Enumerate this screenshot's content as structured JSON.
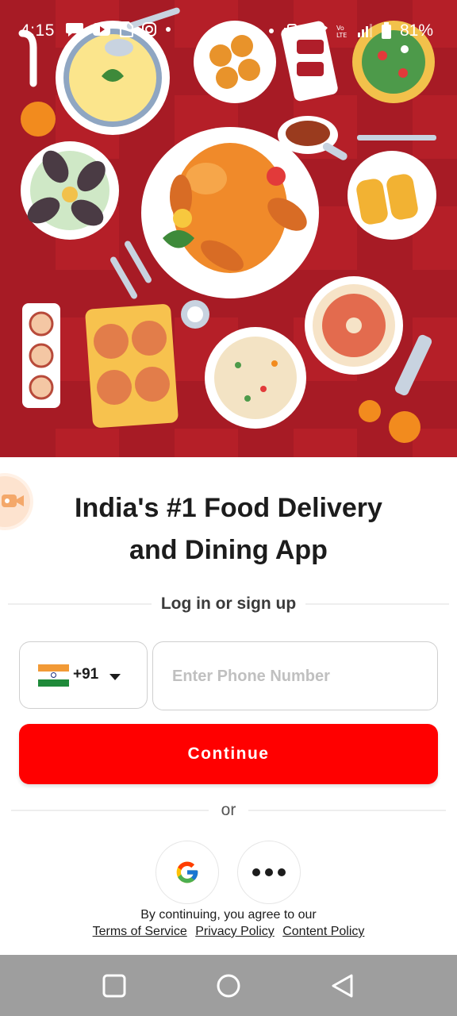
{
  "status_bar": {
    "time": "4:15",
    "battery": "81%",
    "left_icons": [
      "chat-bubble-icon",
      "youtube-icon",
      "sim-icon",
      "instagram-icon",
      "dot-icon"
    ],
    "right_icons": [
      "dot-icon",
      "vibrate-icon",
      "wifi-icon",
      "volte-icon",
      "signal-icon",
      "battery-icon"
    ]
  },
  "hero": {
    "background_color": "#b51f28",
    "illustration": "food-table-illustration"
  },
  "headline": {
    "line1": "India's #1 Food Delivery",
    "line2": "and Dining App"
  },
  "login_divider_label": "Log in or sign up",
  "phone": {
    "country_code": "+91",
    "flag": "india-flag-icon",
    "placeholder": "Enter Phone Number",
    "value": ""
  },
  "continue_label": "Continue",
  "or_label": "or",
  "social": {
    "google": "google-logo-icon",
    "more": "more-options-icon"
  },
  "terms": {
    "intro": "By continuing, you agree to our",
    "links": [
      "Terms of Service",
      "Privacy Policy",
      "Content Policy"
    ]
  },
  "colors": {
    "accent": "#ff0000",
    "text": "#1c1c1c",
    "nav_bar": "#9e9e9e"
  }
}
